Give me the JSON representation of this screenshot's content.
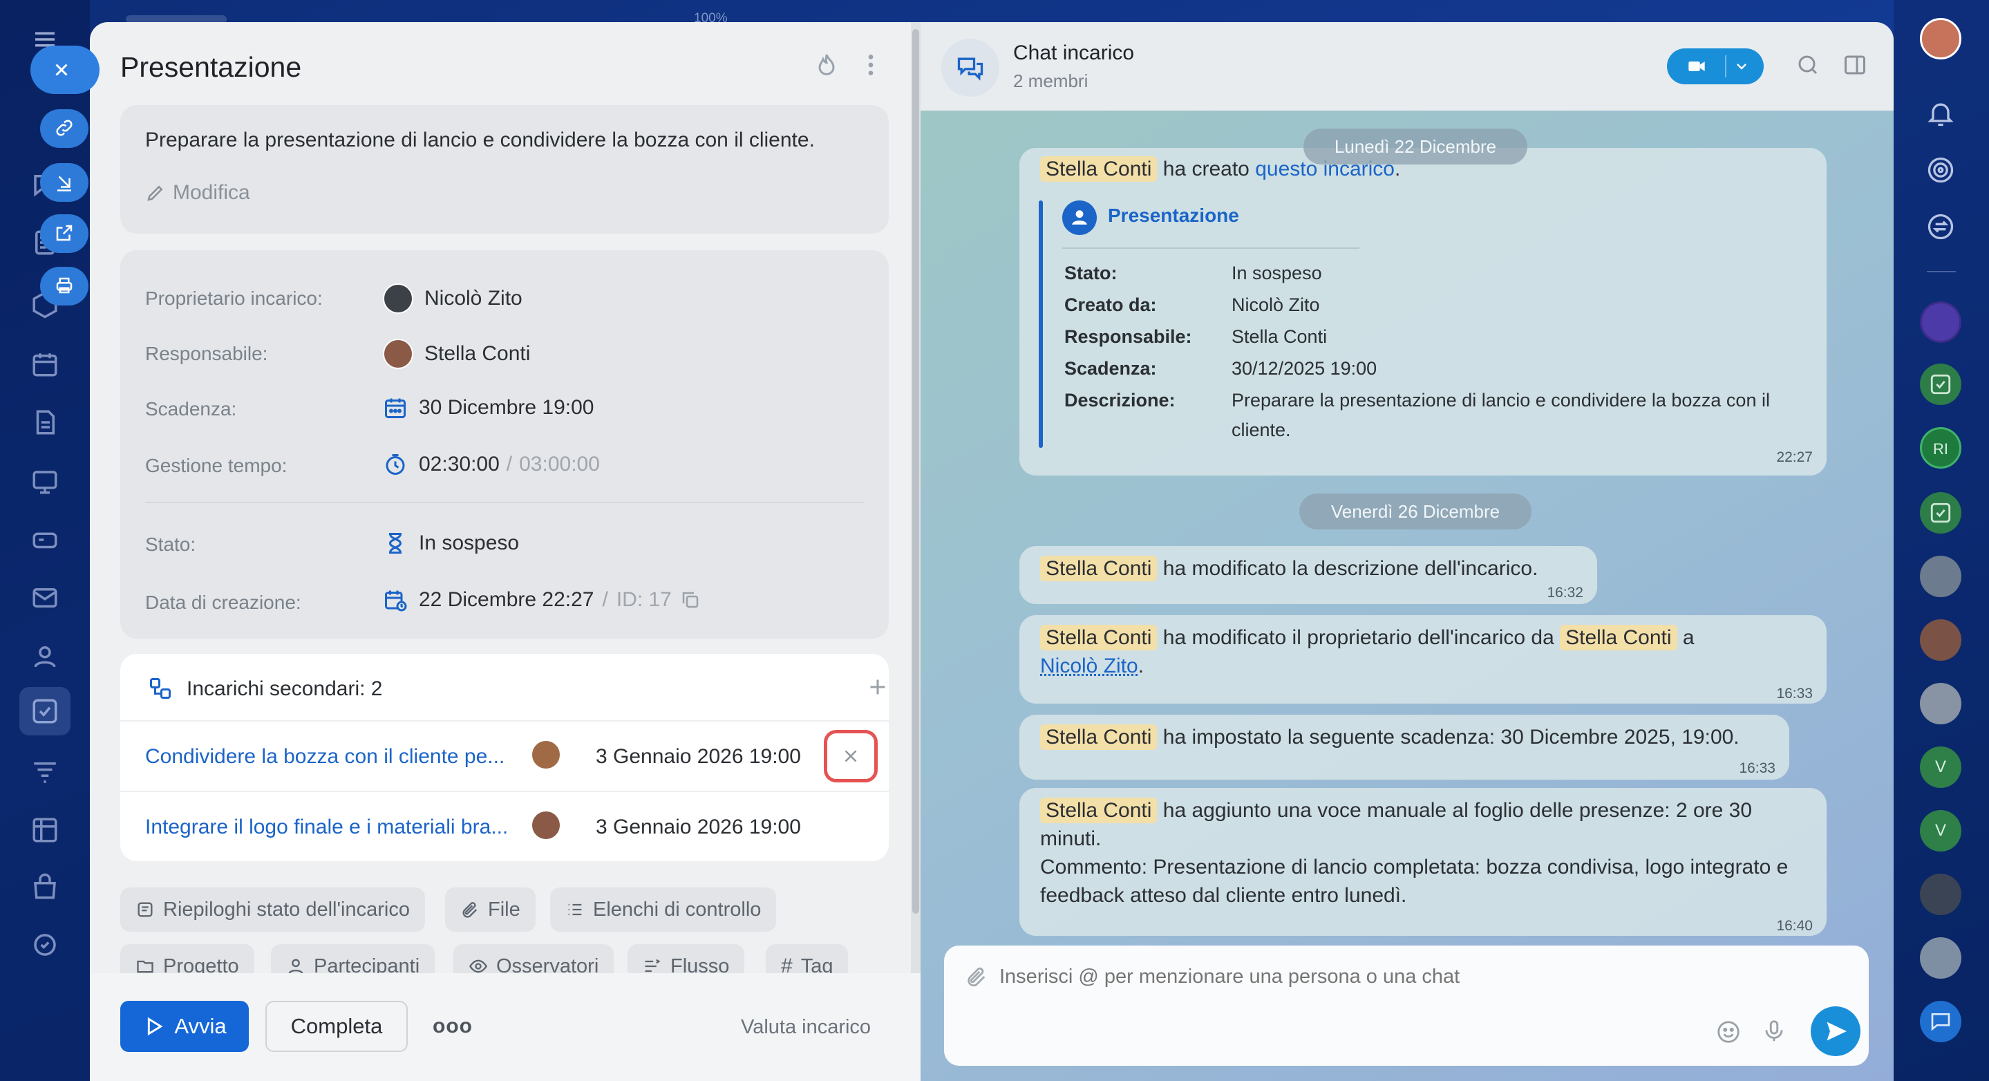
{
  "task": {
    "title": "Presentazione",
    "description": "Preparare la presentazione di lancio e condividere la bozza con il cliente.",
    "edit_label": "Modifica",
    "fields": {
      "owner_label": "Proprietario incarico:",
      "owner_value": "Nicolò Zito",
      "responsible_label": "Responsabile:",
      "responsible_value": "Stella Conti",
      "deadline_label": "Scadenza:",
      "deadline_value": "30 Dicembre 19:00",
      "time_label": "Gestione tempo:",
      "time_spent": "02:30:00",
      "time_sep": "/",
      "time_total": "03:00:00",
      "status_label": "Stato:",
      "status_value": "In sospeso",
      "created_label": "Data di creazione:",
      "created_value": "22 Dicembre 22:27",
      "id_sep": "/",
      "id_value": "ID: 17"
    },
    "subtasks": {
      "title": "Incarichi secondari: 2",
      "items": [
        {
          "title": "Condividere la bozza con il cliente pe...",
          "date": "3 Gennaio 2026 19:00"
        },
        {
          "title": "Integrare il logo finale e i materiali bra...",
          "date": "3 Gennaio 2026 19:00"
        }
      ]
    },
    "chips_row1": [
      "Riepiloghi stato dell'incarico",
      "File",
      "Elenchi di controllo"
    ],
    "chips_row2": [
      "Progetto",
      "Partecipanti",
      "Osservatori",
      "Flusso",
      "Tag"
    ],
    "actions": {
      "start": "Avvia",
      "complete": "Completa",
      "more": "ooo",
      "rate": "Valuta incarico"
    }
  },
  "top_zoom": "100%",
  "chat": {
    "title": "Chat incarico",
    "subtitle": "2 membri",
    "day1": "Lunedì 22 Dicembre",
    "day2": "Venerdì 26 Dicembre",
    "m1": {
      "author": "Stella Conti",
      "text": "ha creato",
      "link": "questo incarico",
      "dot": ".",
      "card_title": "Presentazione",
      "rows": [
        {
          "label": "Stato:",
          "value": "In sospeso"
        },
        {
          "label": "Creato da:",
          "value": "Nicolò Zito"
        },
        {
          "label": "Responsabile:",
          "value": "Stella Conti"
        },
        {
          "label": "Scadenza:",
          "value": "30/12/2025 19:00"
        },
        {
          "label": "Descrizione:",
          "value": "Preparare la presentazione di lancio e condividere la bozza con il cliente."
        }
      ],
      "time": "22:27"
    },
    "m2": {
      "author": "Stella Conti",
      "text": "ha modificato la descrizione dell'incarico.",
      "time": "16:32"
    },
    "m3": {
      "author": "Stella Conti",
      "text": "ha modificato il proprietario dell'incarico da",
      "author2": "Stella Conti",
      "a": "a",
      "link": "Nicolò Zito",
      "dot": ".",
      "time": "16:33"
    },
    "m4": {
      "author": "Stella Conti",
      "text": "ha impostato la seguente scadenza: 30 Dicembre 2025, 19:00.",
      "time": "16:33"
    },
    "m5": {
      "author": "Stella Conti",
      "text": "ha aggiunto una voce manuale al foglio delle presenze: 2 ore 30 minuti.",
      "comment": "Commento: Presentazione di lancio completata: bozza condivisa, logo integrato e feedback atteso dal cliente entro lunedì.",
      "time": "16:40"
    },
    "composer_placeholder": "Inserisci @ per menzionare una persona o una chat"
  },
  "right_rail": {
    "initials_1": "RI",
    "initials_2": "V",
    "initials_3": "V"
  },
  "colors": {
    "accent": "#1b64c8",
    "primary_button": "#1567d8",
    "highlight": "#f3dfa8",
    "close_highlight": "#e55353"
  }
}
